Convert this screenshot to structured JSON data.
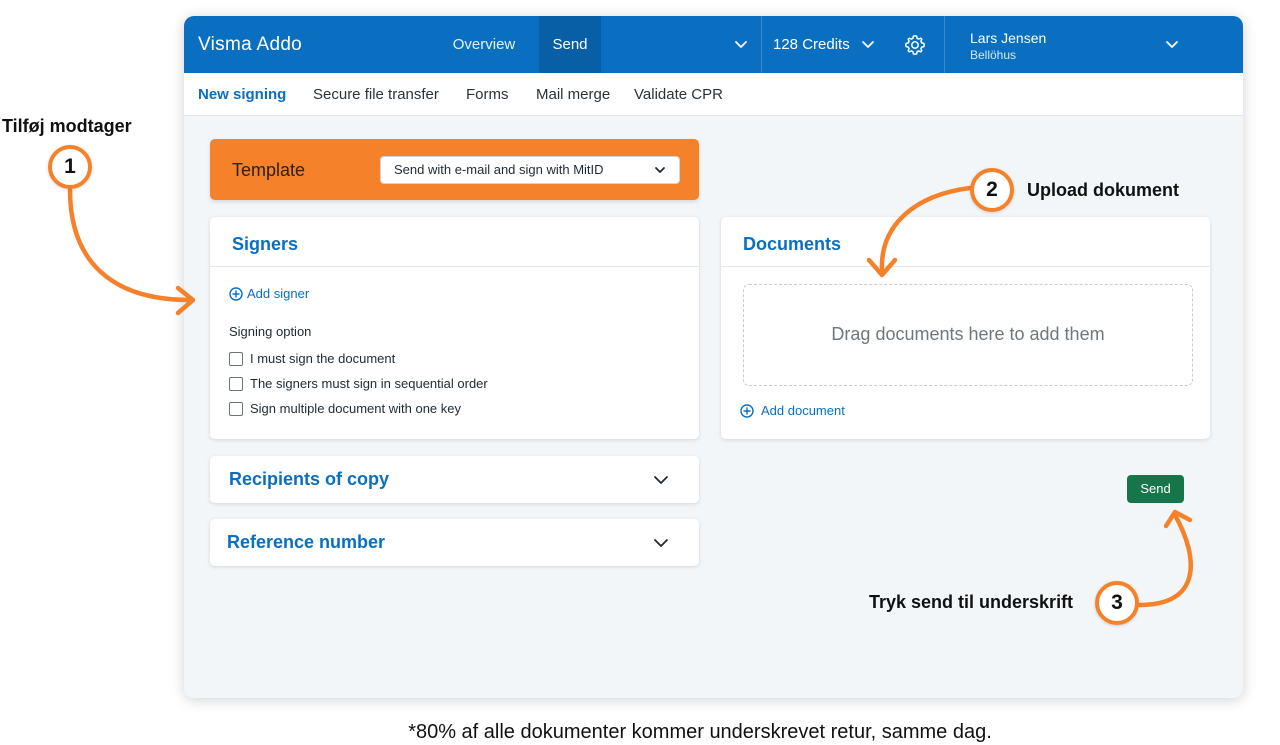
{
  "app": {
    "brand": "Visma Addo",
    "nav": {
      "overview": "Overview",
      "send": "Send"
    },
    "credits": "128 Credits",
    "user": {
      "name": "Lars Jensen",
      "org": "Bellöhus"
    }
  },
  "subnav": {
    "items": [
      "New signing",
      "Secure file transfer",
      "Forms",
      "Mail merge",
      "Validate CPR"
    ],
    "active": "New signing"
  },
  "template": {
    "label": "Template",
    "selected": "Send with e-mail and sign with MitID"
  },
  "signers": {
    "title": "Signers",
    "add_signer": "Add signer",
    "signing_option_label": "Signing option",
    "options": [
      "I must sign the document",
      "The signers must sign in sequential order",
      "Sign multiple document with one key"
    ]
  },
  "documents": {
    "title": "Documents",
    "dropzone_text": "Drag documents here to add them",
    "add_document": "Add document"
  },
  "recipients_of_copy": {
    "title": "Recipients of copy"
  },
  "reference_number": {
    "title": "Reference number"
  },
  "send_button": "Send",
  "annotations": {
    "step1": {
      "number": "1",
      "text": "Tilføj modtager"
    },
    "step2": {
      "number": "2",
      "text": "Upload dokument"
    },
    "step3": {
      "number": "3",
      "text": "Tryk send til underskrift"
    }
  },
  "footnote": "*80% af alle dokumenter kommer underskrevet retur, samme dag.",
  "colors": {
    "primary_blue": "#0a6fc1",
    "accent_orange": "#f5822a",
    "send_green": "#17754a"
  }
}
